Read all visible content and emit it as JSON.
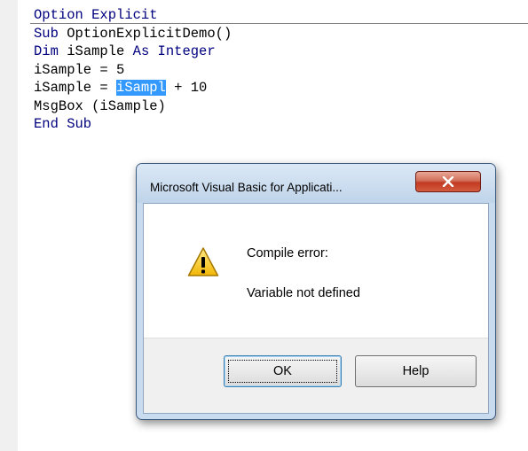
{
  "code": {
    "lines": [
      [
        {
          "t": "Option Explicit",
          "c": "kw"
        }
      ],
      [
        {
          "t": "Sub ",
          "c": "kw"
        },
        {
          "t": "OptionExplicitDemo()",
          "c": ""
        }
      ],
      [
        {
          "t": "Dim ",
          "c": "kw"
        },
        {
          "t": "iSample ",
          "c": ""
        },
        {
          "t": "As Integer",
          "c": "kw"
        }
      ],
      [
        {
          "t": "iSample = 5",
          "c": ""
        }
      ],
      [
        {
          "t": "iSample = ",
          "c": ""
        },
        {
          "t": "iSampl",
          "c": "sel"
        },
        {
          "t": " + 10",
          "c": ""
        }
      ],
      [
        {
          "t": "MsgBox (iSample)",
          "c": ""
        }
      ],
      [
        {
          "t": "End Sub",
          "c": "kw"
        }
      ]
    ]
  },
  "dialog": {
    "title": "Microsoft Visual Basic for Applicati...",
    "close_glyph": "X",
    "icon": "warning-icon",
    "heading": "Compile error:",
    "message": "Variable not defined",
    "ok_label": "OK",
    "help_label": "Help"
  },
  "colors": {
    "keyword": "#00007f",
    "selection": "#3399ff",
    "close_button": "#c23a22"
  }
}
